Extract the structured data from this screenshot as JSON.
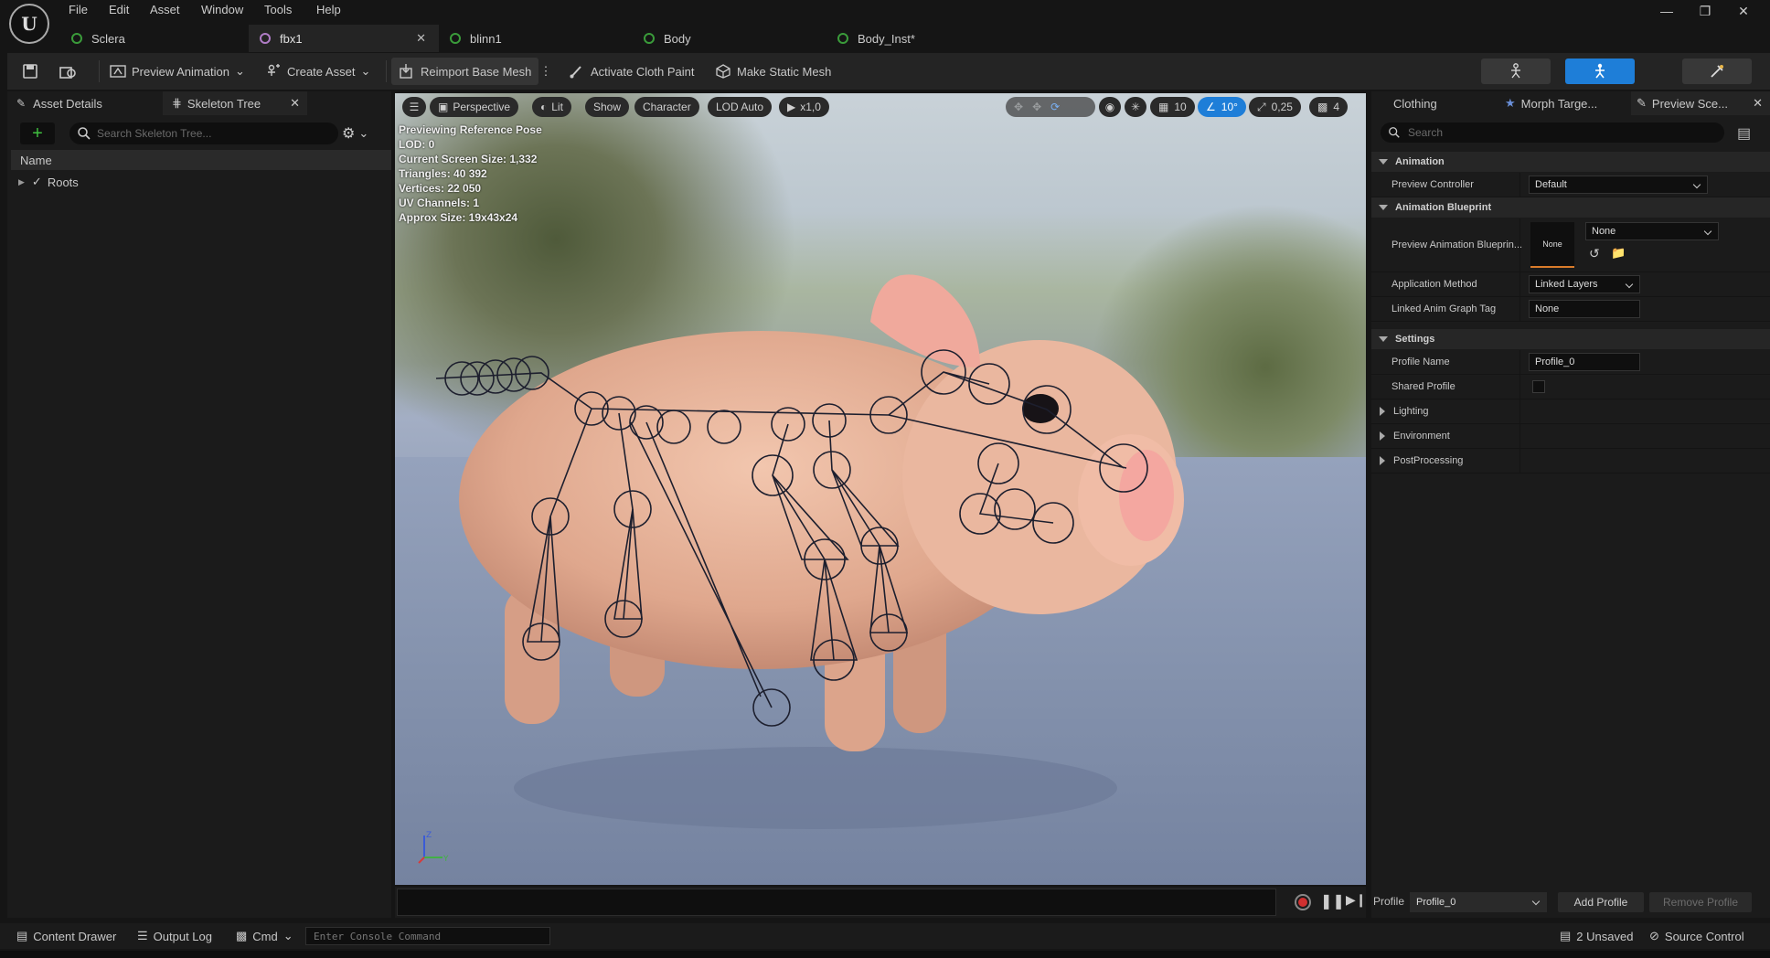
{
  "menu": [
    "File",
    "Edit",
    "Asset",
    "Window",
    "Tools",
    "Help"
  ],
  "doc_tabs": [
    {
      "label": "Sclera",
      "active": false
    },
    {
      "label": "fbx1",
      "active": true
    },
    {
      "label": "blinn1",
      "active": false
    },
    {
      "label": "Body",
      "active": false
    },
    {
      "label": "Body_Inst*",
      "active": false
    }
  ],
  "toolbar": {
    "preview_animation": "Preview Animation",
    "create_asset": "Create Asset",
    "reimport": "Reimport Base Mesh",
    "cloth_paint": "Activate Cloth Paint",
    "static_mesh": "Make Static Mesh"
  },
  "left_panel": {
    "tab_details": "Asset Details",
    "tab_skeleton": "Skeleton Tree",
    "search_placeholder": "Search Skeleton Tree...",
    "column_name": "Name",
    "root_item": "Roots"
  },
  "viewport": {
    "btn_perspective": "Perspective",
    "btn_lit": "Lit",
    "btn_show": "Show",
    "btn_character": "Character",
    "btn_lod": "LOD Auto",
    "btn_speed": "x1,0",
    "grid_value": "10",
    "angle_value": "10°",
    "scale_value": "0,25",
    "camera_value": "4",
    "info": [
      "Previewing Reference Pose",
      "LOD: 0",
      "Current Screen Size: 1,332",
      "Triangles: 40 392",
      "Vertices: 22 050",
      "UV Channels: 1",
      "Approx Size: 19x43x24"
    ]
  },
  "right_panel": {
    "tabs": [
      "Clothing",
      "Morph Targe...",
      "Preview Sce..."
    ],
    "search_placeholder": "Search",
    "sections": {
      "animation": "Animation",
      "anim_blueprint": "Animation Blueprint",
      "settings": "Settings",
      "lighting": "Lighting",
      "environment": "Environment",
      "postprocessing": "PostProcessing"
    },
    "props": {
      "preview_controller_label": "Preview Controller",
      "preview_controller_value": "Default",
      "preview_bp_label": "Preview Animation Blueprin...",
      "preview_bp_thumb": "None",
      "preview_bp_value": "None",
      "application_method_label": "Application Method",
      "application_method_value": "Linked Layers",
      "linked_tag_label": "Linked Anim Graph Tag",
      "linked_tag_value": "None",
      "profile_name_label": "Profile Name",
      "profile_name_value": "Profile_0",
      "shared_profile_label": "Shared Profile"
    },
    "profile_bar": {
      "label": "Profile",
      "value": "Profile_0",
      "add": "Add Profile",
      "remove": "Remove Profile"
    }
  },
  "status_bar": {
    "content_drawer": "Content Drawer",
    "output_log": "Output Log",
    "cmd": "Cmd",
    "console_placeholder": "Enter Console Command",
    "unsaved": "2 Unsaved",
    "source_control": "Source Control"
  }
}
